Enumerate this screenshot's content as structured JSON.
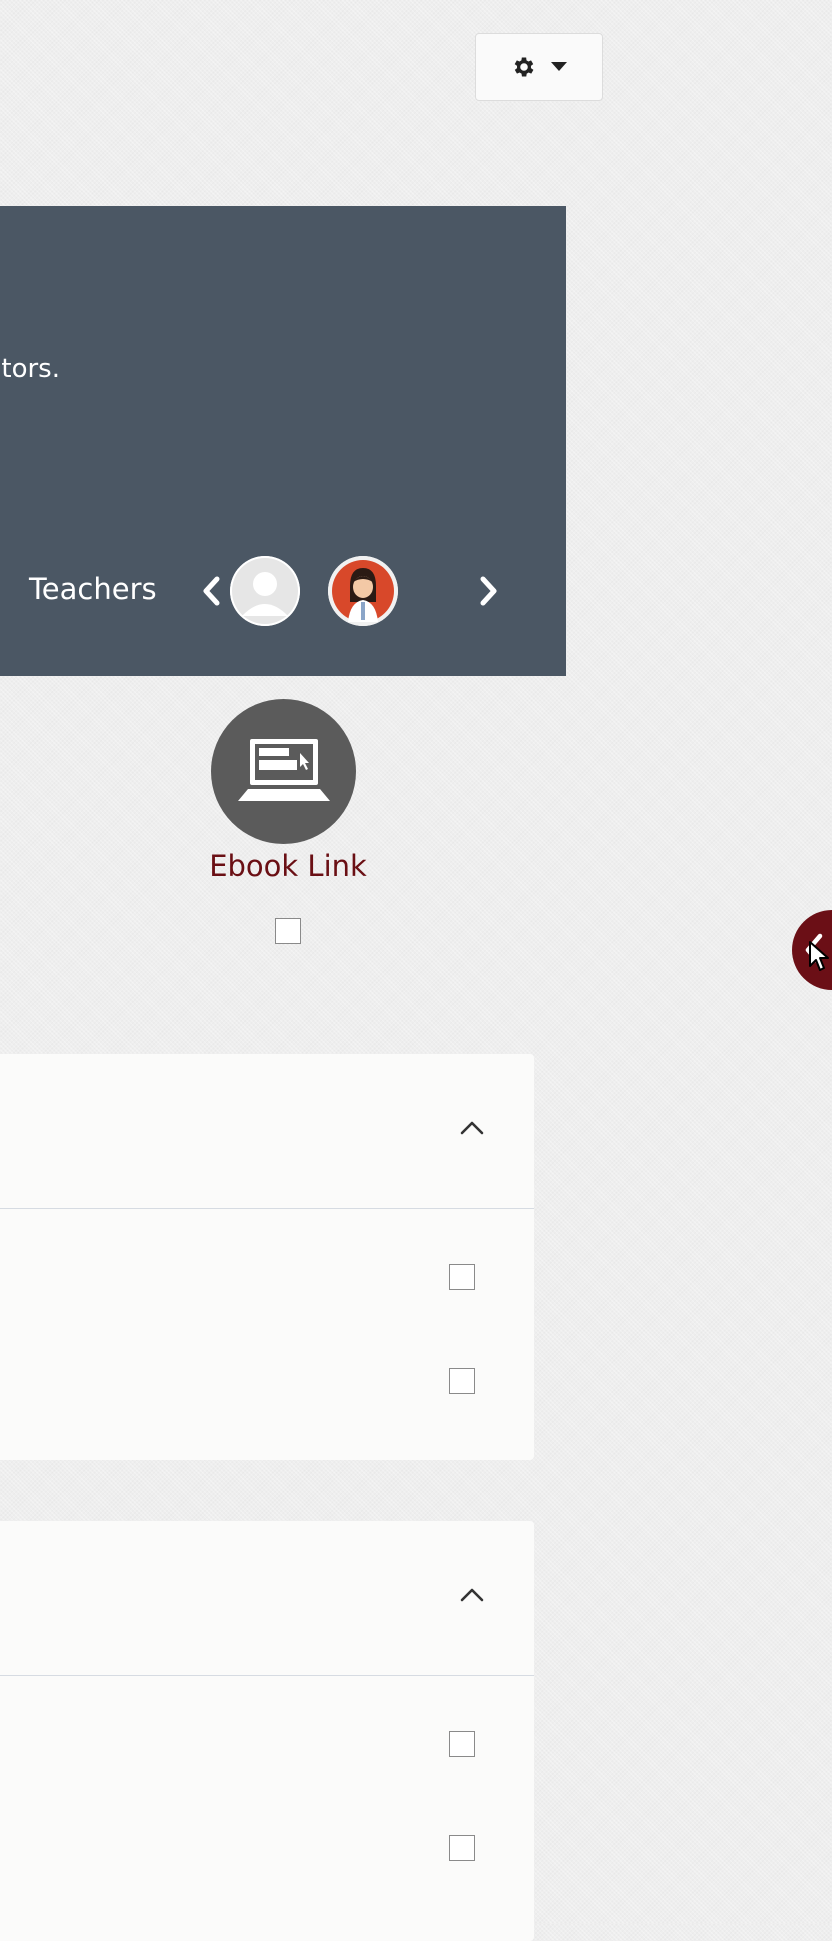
{
  "header": {
    "settings_menu": "gear-icon",
    "settings_dropdown": "caret-down-icon"
  },
  "banner": {
    "description_fragment": "tors.",
    "teachers_label": "Teachers",
    "teachers": [
      {
        "avatar": "default-user-avatar"
      },
      {
        "avatar": "illustrated-user-avatar"
      }
    ]
  },
  "ebook": {
    "label": "Ebook Link",
    "icon": "laptop-icon",
    "completion_checked": false
  },
  "drawer": {
    "toggle_icon": "chevron-left-icon",
    "accent_color": "#6b0f16"
  },
  "sections": [
    {
      "expanded": true,
      "items": [
        {
          "checked": false
        },
        {
          "checked": false
        }
      ]
    },
    {
      "expanded": true,
      "items": [
        {
          "checked": false
        },
        {
          "checked": false
        }
      ]
    }
  ],
  "colors": {
    "banner_bg": "#4b5764",
    "ebook_label": "#6a0f14",
    "page_bg": "#eeeeee"
  }
}
